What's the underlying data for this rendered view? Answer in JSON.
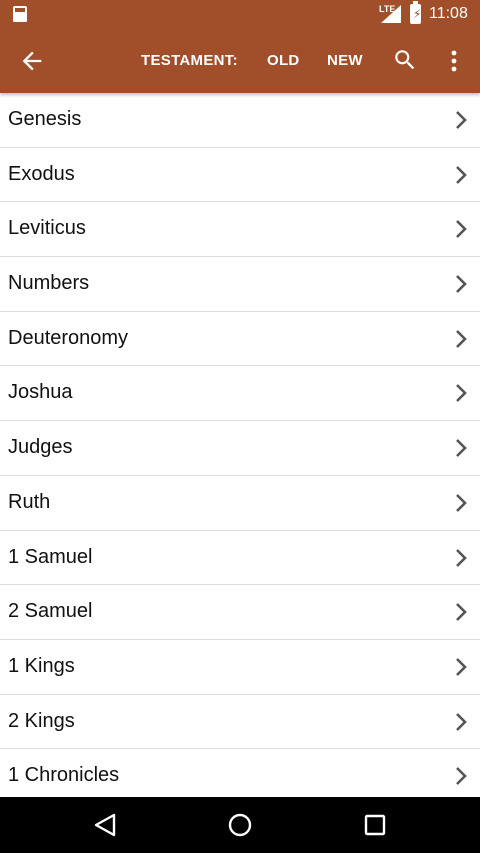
{
  "status_bar": {
    "network": "LTE",
    "time": "11:08",
    "icons": [
      "sd-card-icon",
      "signal-icon",
      "battery-charging-icon"
    ]
  },
  "app_bar": {
    "back_icon": "back-arrow-icon",
    "testament_label": "TESTAMENT:",
    "old_label": "OLD",
    "new_label": "NEW",
    "search_icon": "search-icon",
    "more_icon": "more-vert-icon",
    "colors": {
      "primary": "#a14f2a"
    }
  },
  "books": [
    {
      "label": "Genesis"
    },
    {
      "label": "Exodus"
    },
    {
      "label": "Leviticus"
    },
    {
      "label": "Numbers"
    },
    {
      "label": "Deuteronomy"
    },
    {
      "label": "Joshua"
    },
    {
      "label": "Judges"
    },
    {
      "label": "Ruth"
    },
    {
      "label": "1 Samuel"
    },
    {
      "label": "2 Samuel"
    },
    {
      "label": "1 Kings"
    },
    {
      "label": "2 Kings"
    },
    {
      "label": "1 Chronicles"
    }
  ],
  "nav_bar": {
    "icons": [
      "nav-back-icon",
      "nav-home-icon",
      "nav-recents-icon"
    ]
  }
}
